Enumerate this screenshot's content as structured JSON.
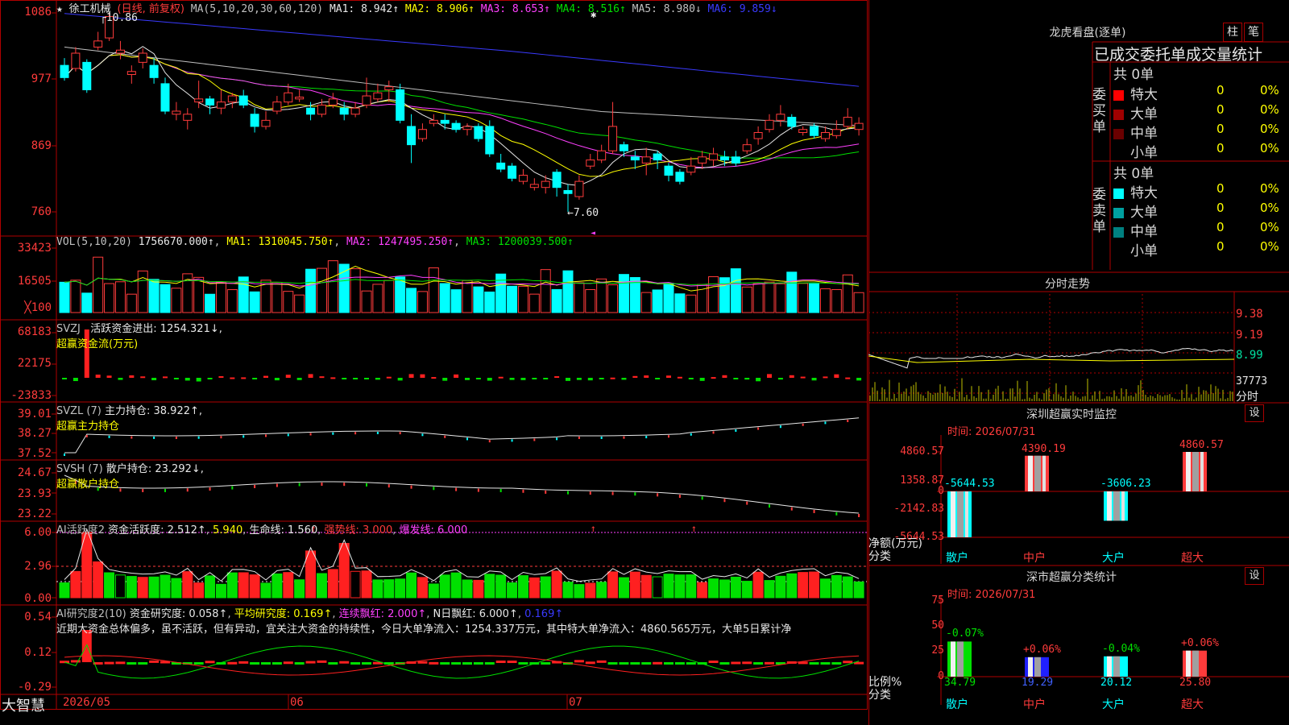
{
  "app": {
    "brand": "大智慧"
  },
  "stock": {
    "name": "徐工机械",
    "period_label": "(日线, 前复权)",
    "ma_group": "MA(5,10,20,30,60,120)",
    "ma": [
      {
        "label": "MA1:",
        "value": "8.942",
        "dir": "↑",
        "color": "#e8e8e8"
      },
      {
        "label": "MA2:",
        "value": "8.906",
        "dir": "↑",
        "color": "#ffff00"
      },
      {
        "label": "MA3:",
        "value": "8.653",
        "dir": "↑",
        "color": "#ff40ff"
      },
      {
        "label": "MA4:",
        "value": "8.516",
        "dir": "↑",
        "color": "#00e000"
      },
      {
        "label": "MA5:",
        "value": "8.980",
        "dir": "↓",
        "color": "#c0c0c0"
      },
      {
        "label": "MA6:",
        "value": "9.859",
        "dir": "↓",
        "color": "#3a3aff"
      }
    ],
    "price_axis": [
      "1086",
      "977",
      "869",
      "760"
    ],
    "high_note": "10.86",
    "low_note": "←7.60",
    "candles": [
      [
        10.0,
        9.8,
        10.12,
        9.75
      ],
      [
        9.95,
        10.2,
        10.3,
        9.9
      ],
      [
        10.05,
        9.6,
        10.1,
        9.55
      ],
      [
        10.3,
        10.4,
        10.55,
        10.25
      ],
      [
        10.45,
        10.8,
        10.86,
        10.4
      ],
      [
        10.2,
        10.25,
        10.4,
        10.1
      ],
      [
        9.85,
        9.9,
        10.0,
        9.7
      ],
      [
        10.05,
        10.2,
        10.28,
        9.95
      ],
      [
        10.0,
        9.8,
        10.12,
        9.7
      ],
      [
        9.7,
        9.25,
        9.8,
        9.2
      ],
      [
        9.2,
        9.25,
        9.4,
        9.1
      ],
      [
        9.1,
        9.2,
        9.3,
        8.95
      ],
      [
        9.4,
        9.45,
        9.75,
        9.3
      ],
      [
        9.45,
        9.35,
        9.5,
        9.2
      ],
      [
        9.3,
        9.4,
        9.6,
        9.2
      ],
      [
        9.4,
        9.5,
        9.55,
        9.3
      ],
      [
        9.5,
        9.35,
        9.6,
        9.3
      ],
      [
        9.2,
        9.0,
        9.3,
        8.9
      ],
      [
        9.0,
        9.1,
        9.25,
        8.95
      ],
      [
        9.25,
        9.4,
        9.5,
        9.2
      ],
      [
        9.4,
        9.55,
        9.7,
        9.35
      ],
      [
        9.45,
        9.48,
        9.6,
        9.4
      ],
      [
        9.3,
        9.2,
        9.4,
        9.1
      ],
      [
        9.2,
        9.35,
        9.45,
        9.15
      ],
      [
        9.35,
        9.45,
        9.55,
        9.3
      ],
      [
        9.3,
        9.2,
        9.4,
        9.1
      ],
      [
        9.2,
        9.3,
        9.4,
        9.15
      ],
      [
        9.35,
        9.5,
        9.8,
        9.3
      ],
      [
        9.45,
        9.55,
        9.7,
        9.4
      ],
      [
        9.6,
        9.65,
        9.75,
        9.4
      ],
      [
        9.6,
        9.1,
        9.7,
        9.05
      ],
      [
        9.0,
        8.7,
        9.2,
        8.4
      ],
      [
        8.8,
        8.95,
        9.05,
        8.75
      ],
      [
        9.05,
        9.1,
        9.2,
        9.0
      ],
      [
        9.1,
        9.05,
        9.2,
        8.95
      ],
      [
        9.05,
        8.95,
        9.1,
        8.9
      ],
      [
        8.95,
        9.0,
        9.05,
        8.85
      ],
      [
        9.0,
        8.8,
        9.05,
        8.75
      ],
      [
        9.0,
        8.55,
        9.1,
        8.5
      ],
      [
        8.4,
        8.3,
        8.55,
        8.25
      ],
      [
        8.35,
        8.15,
        8.4,
        8.1
      ],
      [
        8.1,
        8.2,
        8.3,
        8.05
      ],
      [
        8.0,
        8.05,
        8.15,
        7.95
      ],
      [
        8.0,
        8.1,
        8.2,
        7.9
      ],
      [
        8.25,
        8.0,
        8.3,
        7.85
      ],
      [
        7.95,
        7.9,
        8.05,
        7.6
      ],
      [
        7.85,
        8.1,
        8.2,
        7.8
      ],
      [
        8.35,
        8.45,
        8.55,
        8.3
      ],
      [
        8.45,
        8.6,
        8.7,
        8.4
      ],
      [
        8.6,
        9.0,
        9.4,
        8.55
      ],
      [
        8.7,
        8.6,
        8.75,
        8.5
      ],
      [
        8.5,
        8.45,
        8.6,
        8.3
      ],
      [
        8.4,
        8.5,
        8.65,
        8.2
      ],
      [
        8.55,
        8.45,
        8.6,
        8.3
      ],
      [
        8.35,
        8.2,
        8.4,
        8.1
      ],
      [
        8.25,
        8.1,
        8.3,
        8.05
      ],
      [
        8.25,
        8.35,
        8.5,
        8.2
      ],
      [
        8.4,
        8.5,
        8.6,
        8.3
      ],
      [
        8.45,
        8.55,
        8.65,
        8.35
      ],
      [
        8.5,
        8.45,
        8.6,
        8.35
      ],
      [
        8.5,
        8.4,
        8.6,
        8.35
      ],
      [
        8.6,
        8.7,
        8.8,
        8.55
      ],
      [
        8.8,
        8.9,
        9.0,
        8.7
      ],
      [
        8.95,
        9.1,
        9.2,
        8.9
      ],
      [
        9.1,
        9.2,
        9.35,
        9.0
      ],
      [
        9.15,
        9.0,
        9.2,
        8.95
      ],
      [
        8.9,
        8.95,
        9.0,
        8.85
      ],
      [
        9.0,
        8.85,
        9.05,
        8.8
      ],
      [
        8.8,
        8.9,
        9.0,
        8.75
      ],
      [
        8.85,
        8.95,
        9.1,
        8.8
      ],
      [
        9.0,
        9.15,
        9.3,
        8.95
      ],
      [
        8.95,
        9.05,
        9.15,
        8.85
      ]
    ]
  },
  "vol": {
    "header": "VOL(5,10,20)",
    "current": "1756670.000↑",
    "ma1": "MA1: 1310045.750↑",
    "ma2": "MA2: 1247495.250↑",
    "ma3": "MA3: 1200039.500↑",
    "axis": [
      "33423",
      "16505"
    ],
    "unit": "╳100"
  },
  "svzj": {
    "name": "SVZJ",
    "desc": "活跃资金进出: 1254.321↓,",
    "sub": "超赢资金流(万元)",
    "axis": [
      "68183",
      "22175",
      "-23833"
    ]
  },
  "svzl": {
    "name": "SVZL (7)",
    "desc": "主力持仓: 38.922↑,",
    "sub": "超赢主力持仓",
    "axis": [
      "39.01",
      "38.27",
      "37.52"
    ]
  },
  "svsh": {
    "name": "SVSH (7)",
    "desc": "散户持仓: 23.292↓,",
    "sub": "超赢散户持仓",
    "axis": [
      "24.67",
      "23.93",
      "23.22"
    ]
  },
  "ai_active": {
    "name": "AI活跃度2",
    "m1": "资金活跃度: 2.512↑",
    "m2": "5.940",
    "m3": "生命线: 1.560",
    "m4": "强势线: 3.000",
    "m5": "爆发线: 6.000",
    "axis": [
      "6.00",
      "2.96",
      "0.00"
    ]
  },
  "ai_research": {
    "name": "AI研究度2(10)",
    "m1": "资金研究度: 0.058↑",
    "m2": "平均研究度: 0.169↑",
    "m3": "连续飘红: 2.000↑",
    "m4": "N日飘红: 6.000↑",
    "m5": "0.169↑",
    "summary": "近期大资金总体偏多，虽不活跃，但有异动，宜关注大资金的持续性，今日大单净流入：1254.337万元，其中特大单净流入：4860.565万元，大单5日累计净",
    "axis": [
      "0.54",
      "0.12",
      "-0.29"
    ]
  },
  "date_axis": [
    "2026/05",
    "06",
    "07"
  ],
  "dragon": {
    "title": "龙虎看盘(逐单)",
    "tab1": "柱",
    "tab2": "笔",
    "header": "已成交委托单成交量统计",
    "buy_side": "委买单",
    "sell_side": "委卖单",
    "buy_total": "共 0单",
    "sell_total": "共 0单",
    "buy_rows": [
      {
        "label": "特大",
        "count": "0",
        "pct": "0%",
        "color": "#ff0000"
      },
      {
        "label": "大单",
        "count": "0",
        "pct": "0%",
        "color": "#a00000"
      },
      {
        "label": "中单",
        "count": "0",
        "pct": "0%",
        "color": "#6a0000"
      },
      {
        "label": "小单",
        "count": "0",
        "pct": "0%",
        "color": "#000000"
      }
    ],
    "sell_rows": [
      {
        "label": "特大",
        "count": "0",
        "pct": "0%",
        "color": "#00ffff"
      },
      {
        "label": "大单",
        "count": "0",
        "pct": "0%",
        "color": "#00a0a0"
      },
      {
        "label": "中单",
        "count": "0",
        "pct": "0%",
        "color": "#008080"
      },
      {
        "label": "小单",
        "count": "0",
        "pct": "0%",
        "color": "#000000"
      }
    ]
  },
  "intraday": {
    "title": "分时走势",
    "axis": [
      "9.38",
      "9.19",
      "8.99"
    ],
    "vol_label": "37773",
    "unit_label": "分时"
  },
  "sz_monitor": {
    "title": "深圳超赢实时监控",
    "gear": "设",
    "time": "时间: 2026/07/31",
    "axis": [
      "4860.57",
      "1358.87",
      "0",
      "-2142.83",
      "-5644.53"
    ],
    "bars": [
      {
        "label": "-5644.53",
        "value": -5644.53,
        "color": "#00ffff"
      },
      {
        "label": "4390.19",
        "value": 4390.19,
        "color": "#ff3b3b"
      },
      {
        "label": "-3606.23",
        "value": -3606.23,
        "color": "#00ffff"
      },
      {
        "label": "4860.57",
        "value": 4860.57,
        "color": "#ff3b3b"
      }
    ],
    "cats": [
      "散户",
      "中户",
      "大户",
      "超大"
    ],
    "ylabel": "净额(万元)",
    "xlabel": "分类"
  },
  "sz_class": {
    "title": "深市超赢分类统计",
    "gear": "设",
    "time": "时间: 2026/07/31",
    "axis": [
      "75",
      "50",
      "25",
      "0"
    ],
    "bars": [
      {
        "pct": 34.79,
        "value": "34.79",
        "delta": "-0.07%",
        "color": "#00e000",
        "deltaColor": "#00e000"
      },
      {
        "pct": 19.29,
        "value": "19.29",
        "delta": "+0.06%",
        "color": "#2020ff",
        "deltaColor": "#ff3b3b"
      },
      {
        "pct": 20.12,
        "value": "20.12",
        "delta": "-0.04%",
        "color": "#00ffff",
        "deltaColor": "#00e000"
      },
      {
        "pct": 25.8,
        "value": "25.80",
        "delta": "+0.06%",
        "color": "#ff3b3b",
        "deltaColor": "#ff3b3b"
      }
    ],
    "cats": [
      "散户",
      "中户",
      "大户",
      "超大"
    ],
    "ylabel": "比例%",
    "xlabel": "分类"
  }
}
